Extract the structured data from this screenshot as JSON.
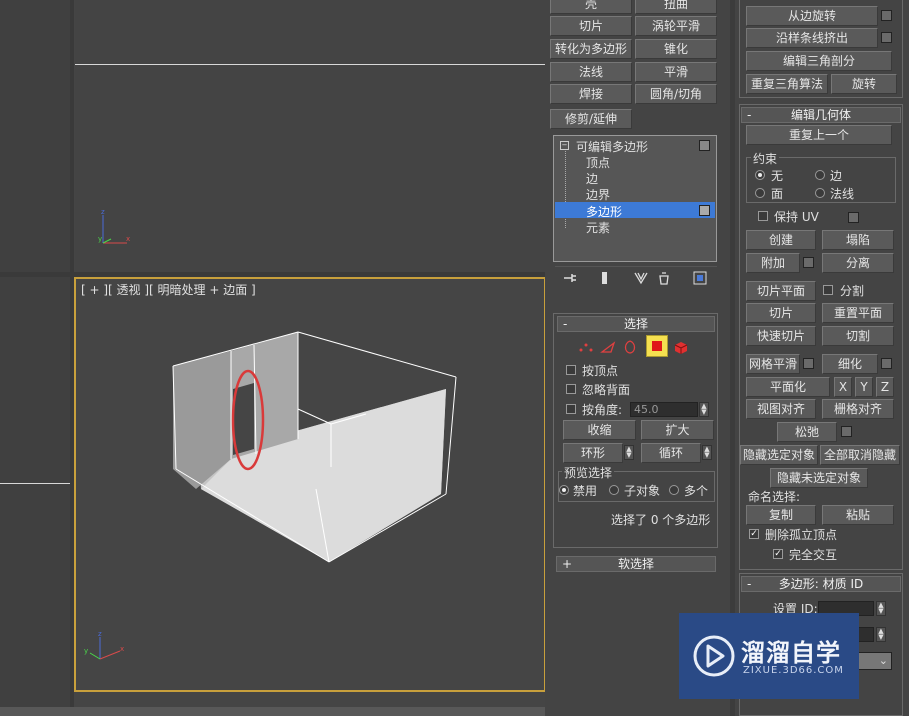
{
  "viewport": {
    "label": "[ + ][ 透视 ][ 明暗处理 + 边面 ]",
    "axis_labels": {
      "z": "z",
      "y": "y",
      "x": "x"
    }
  },
  "modify_buttons": [
    "壳",
    "扭曲",
    "切片",
    "涡轮平滑",
    "转化为多边形",
    "锥化",
    "法线",
    "平滑",
    "焊接",
    "圆角/切角",
    "修剪/延伸"
  ],
  "stack": {
    "root": "可编辑多边形",
    "items": [
      "顶点",
      "边",
      "边界",
      "多边形",
      "元素"
    ],
    "selected_index": 3
  },
  "stack_toolbar_icons": [
    "pin-stack-icon",
    "show-end-result-icon",
    "make-unique-icon",
    "remove-modifier-icon",
    "configure-modifier-sets-icon"
  ],
  "selection": {
    "header": "选择",
    "by_vertex": "按顶点",
    "ignore_backfacing": "忽略背面",
    "by_angle": "按角度:",
    "angle_value": "45.0",
    "shrink": "收缩",
    "grow": "扩大",
    "ring": "环形",
    "loop": "循环",
    "preview_title": "预览选择",
    "preview_options": [
      "禁用",
      "子对象",
      "多个"
    ],
    "status": "选择了 0 个多边形"
  },
  "soft_selection": {
    "header": "软选择",
    "plus": "+"
  },
  "right_top": {
    "lathe": "从边旋转",
    "extrude_spline": "沿样条线挤出",
    "edit_tri": "编辑三角剖分",
    "retri": "重复三角算法",
    "turn": "旋转"
  },
  "edit_geometry": {
    "header": "编辑几何体",
    "repeat_last": "重复上一个",
    "constraints": "约束",
    "constraint_options": [
      "无",
      "边",
      "面",
      "法线"
    ],
    "preserve_uv": "保持 UV",
    "create": "创建",
    "collapse": "塌陷",
    "attach": "附加",
    "detach": "分离",
    "slice_plane": "切片平面",
    "split": "分割",
    "slice": "切片",
    "reset_plane": "重置平面",
    "quickslice": "快速切片",
    "cut": "切割",
    "meshsmooth": "网格平滑",
    "tessellate": "细化",
    "make_planar": "平面化",
    "x": "X",
    "y": "Y",
    "z": "Z",
    "view_align": "视图对齐",
    "grid_align": "栅格对齐",
    "relax": "松弛",
    "hide_selected": "隐藏选定对象",
    "unhide_all": "全部取消隐藏",
    "hide_unselected": "隐藏未选定对象",
    "named_selections": "命名选择:",
    "copy": "复制",
    "paste": "粘贴",
    "delete_isolated": "删除孤立顶点",
    "full_interactivity": "完全交互"
  },
  "material_ids": {
    "header": "多边形: 材质 ID",
    "set_id": "设置 ID:"
  },
  "watermark": {
    "title": "溜溜自学",
    "url": "ZIXUE.3D66.COM"
  },
  "colors": {
    "viewport_border": "#c8a03c",
    "selection_highlight": "#3d7ad6",
    "annotation_circle": "#d93a3a",
    "watermark_bg": "#2a4a86"
  }
}
